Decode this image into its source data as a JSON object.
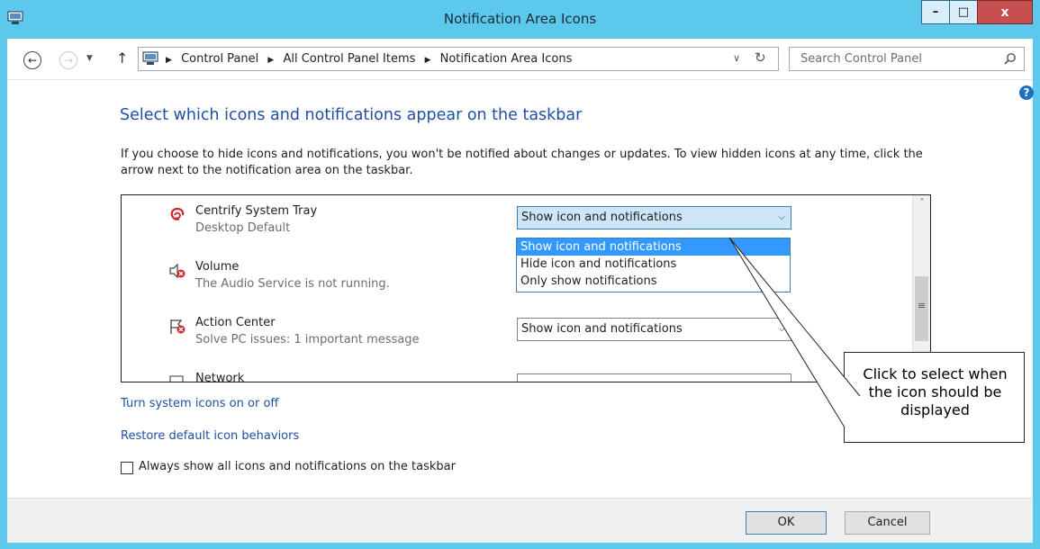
{
  "window": {
    "title": "Notification Area Icons",
    "minimize_label": "–",
    "maximize_label": "□",
    "close_label": "x"
  },
  "nav": {
    "back_icon": "←",
    "forward_icon": "→",
    "up_icon": "↑",
    "dropdown_icon": "▼",
    "breadcrumb": [
      "Control Panel",
      "All Control Panel Items",
      "Notification Area Icons"
    ],
    "separator": "▶",
    "address_dropdown_icon": "∨",
    "refresh_icon": "↻",
    "search_placeholder": "Search Control Panel"
  },
  "help_icon": "?",
  "page": {
    "heading": "Select which icons and notifications appear on the taskbar",
    "description": "If you choose to hide icons and notifications, you won't be notified about changes or updates. To view hidden icons at any time, click the arrow next to the notification area on the taskbar."
  },
  "icons": [
    {
      "name": "Centrify System Tray",
      "subtitle": "Desktop  Default",
      "icon": "centrify-icon",
      "behavior": "Show icon and notifications",
      "dropdown_open": true
    },
    {
      "name": "Volume",
      "subtitle": "The Audio Service is not running.",
      "icon": "volume-icon",
      "behavior": "",
      "dropdown_open": false
    },
    {
      "name": "Action Center",
      "subtitle": "Solve PC issues: 1 important message",
      "icon": "action-center-icon",
      "behavior": "Show icon and notifications",
      "dropdown_open": false
    },
    {
      "name": "Network",
      "subtitle": "",
      "icon": "network-icon",
      "behavior": "",
      "dropdown_open": false
    }
  ],
  "dropdown_options": [
    "Show icon and notifications",
    "Hide icon and notifications",
    "Only show notifications"
  ],
  "dropdown_selected_index": 0,
  "scrollbar": {
    "up": "˄",
    "down": "˅",
    "grip": "≡"
  },
  "links": {
    "system_icons": "Turn system icons on or off",
    "restore": "Restore default icon behaviors"
  },
  "always_show": {
    "label": "Always show all icons and notifications on the taskbar",
    "checked": false
  },
  "buttons": {
    "ok": "OK",
    "cancel": "Cancel"
  },
  "callout": {
    "line1": "Click to select when",
    "line2": "the icon should be",
    "line3": "displayed"
  },
  "colors": {
    "title_bar": "#5cc8ec",
    "link": "#1e4fa3",
    "selection": "#3399ff",
    "close_button": "#c74e4e"
  }
}
